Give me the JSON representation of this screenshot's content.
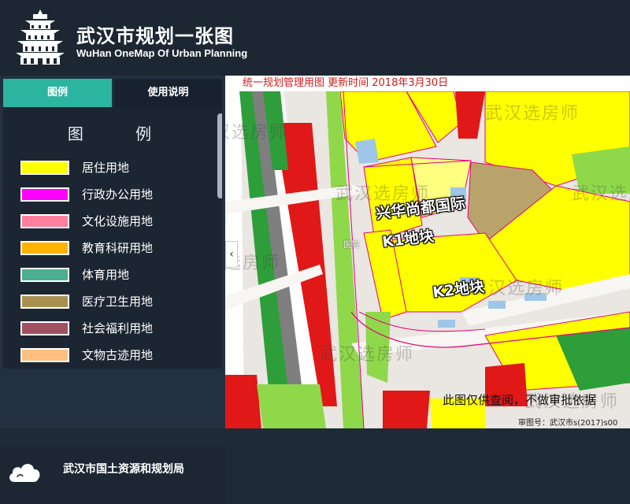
{
  "app": {
    "title": "武汉市规划一张图",
    "subtitle": "WuHan OneMap Of Urban Planning",
    "logo_icon": "yellow-crane-tower-icon"
  },
  "sidebar": {
    "tabs": [
      {
        "label": "图例",
        "active": true
      },
      {
        "label": "使用说明",
        "active": false
      }
    ],
    "legend_title": "图 例",
    "legend_items": [
      {
        "label": "居住用地",
        "color": "#ffff00"
      },
      {
        "label": "行政办公用地",
        "color": "#ff00ff"
      },
      {
        "label": "文化设施用地",
        "color": "#ff7f9f"
      },
      {
        "label": "教育科研用地",
        "color": "#ffb300"
      },
      {
        "label": "体育用地",
        "color": "#4caf8f"
      },
      {
        "label": "医疗卫生用地",
        "color": "#a89050"
      },
      {
        "label": "社会福利用地",
        "color": "#a05060"
      },
      {
        "label": "文物古迹用地",
        "color": "#ffbf80"
      }
    ],
    "footer": {
      "icon": "cloud-icon",
      "bureau_name": "武汉市国土资源和规划局"
    }
  },
  "map": {
    "caption": "统一规划管理用图  更新时间  2018年3月30日",
    "collapse_icon": "chevron-left-icon",
    "collapse_glyph": "‹",
    "labels": {
      "k1_line1": "兴华尚都国际",
      "k1_line2": "K1地块",
      "k2": "K2地块",
      "road_text": "医院"
    },
    "disclaimer": "此图仅供查阅，不做审批依据",
    "approval_no": "审图号：武汉市s(2017)s00",
    "watermark": "武汉选房师"
  },
  "colors": {
    "residential": "#ffff00",
    "green_space": "#7bd64f",
    "industrial": "#d92020",
    "road": "#f2f2f2",
    "accent": "#2bb5a0"
  }
}
